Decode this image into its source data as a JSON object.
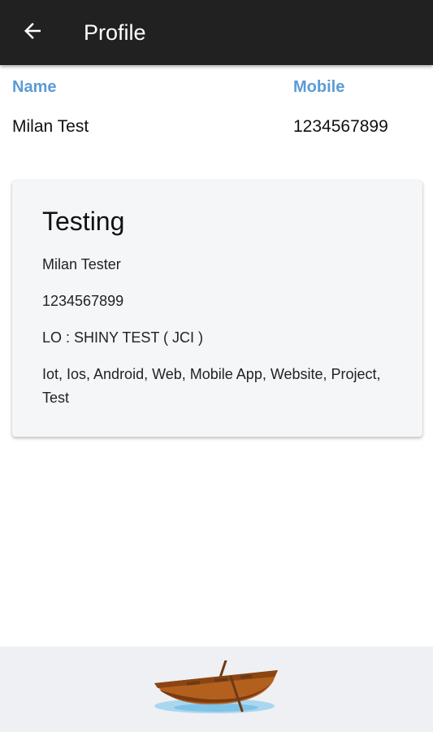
{
  "header": {
    "title": "Profile"
  },
  "profile": {
    "name_label": "Name",
    "name_value": "Milan Test",
    "mobile_label": "Mobile",
    "mobile_value": "1234567899"
  },
  "card": {
    "title": "Testing",
    "contact_name": "Milan Tester",
    "phone": "1234567899",
    "lo": "LO : SHINY TEST ( JCI )",
    "tags": "Iot, Ios, Android, Web, Mobile App, Website, Project, Test"
  },
  "icons": {
    "back": "arrow-back-icon",
    "footer_logo": "rowboat-logo"
  },
  "colors": {
    "appbar": "#212121",
    "label_accent": "#5b9bd5",
    "card_bg": "#f4f6f8"
  }
}
